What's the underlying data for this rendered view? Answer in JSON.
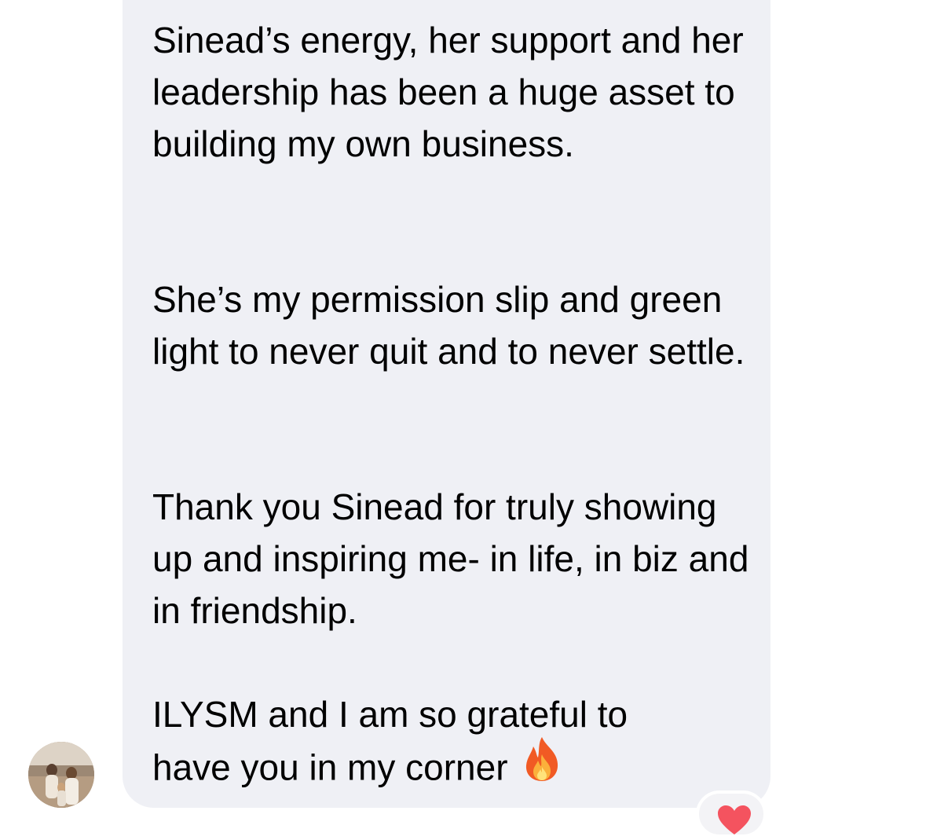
{
  "message": {
    "paragraph_1": "Sinead’s energy, her support and her leadership has been a huge asset to building my own business.",
    "paragraph_2": "She’s my permission slip and green light to never quit and to never settle.",
    "paragraph_3": "Thank you Sinead for truly showing up and inspiring me- in life, in biz and in friendship.",
    "paragraph_4_line_1": "ILYSM and I am so grateful to",
    "paragraph_4_line_2": "have you in my corner",
    "emoji": "fire-emoji"
  },
  "sender": {
    "avatar": "profile-photo"
  },
  "reaction": {
    "icon": "heart-icon",
    "color": "#f4535f"
  },
  "colors": {
    "bubble": "#eff0f5",
    "background": "#ffffff",
    "text": "#000000"
  }
}
